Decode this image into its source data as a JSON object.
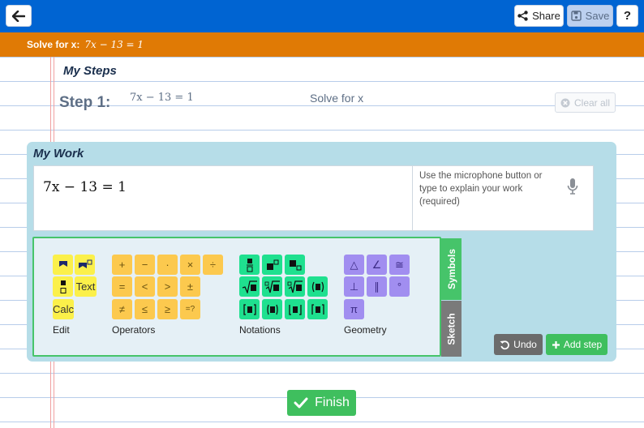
{
  "header": {
    "share_label": "Share",
    "save_label": "Save",
    "help_label": "?"
  },
  "problem": {
    "prefix": "Solve for x:",
    "equation": "7x − 13 = 1"
  },
  "steps": {
    "title": "My Steps",
    "step_label": "Step 1:",
    "equation": "7x − 13 = 1",
    "description": "Solve for x",
    "clear_label": "Clear all"
  },
  "work": {
    "title": "My Work",
    "expression": "7x − 13 = 1",
    "explain_placeholder": "Use the microphone button or type to explain your work (required)"
  },
  "keyboard": {
    "groups": {
      "edit": "Edit",
      "operators": "Operators",
      "notations": "Notations",
      "geometry": "Geometry"
    },
    "edit_keys": {
      "text": "Text",
      "calc": "Calc"
    },
    "operator_keys": [
      "+",
      "−",
      "·",
      "×",
      "÷",
      "=",
      "<",
      ">",
      "±",
      "≠",
      "≤",
      "≥",
      "=?"
    ],
    "notation_keys": [
      "fraction",
      "superscript",
      "subscript",
      "sqrt",
      "cube-root",
      "nth-root",
      "parentheses",
      "brackets",
      "absolute",
      "lower",
      "upper"
    ],
    "geometry_keys": [
      "△",
      "∠",
      "≅",
      "⊥",
      "∥",
      "°",
      "π"
    ]
  },
  "tabs": {
    "symbols": "Symbols",
    "sketch": "Sketch"
  },
  "actions": {
    "undo_label": "Undo",
    "add_step_label": "Add step",
    "finish_label": "Finish"
  },
  "colors": {
    "header_blue": "#0064d2",
    "problem_orange": "#e07a05",
    "green": "#3fbf5e",
    "panel_blue": "#b6dde8"
  }
}
